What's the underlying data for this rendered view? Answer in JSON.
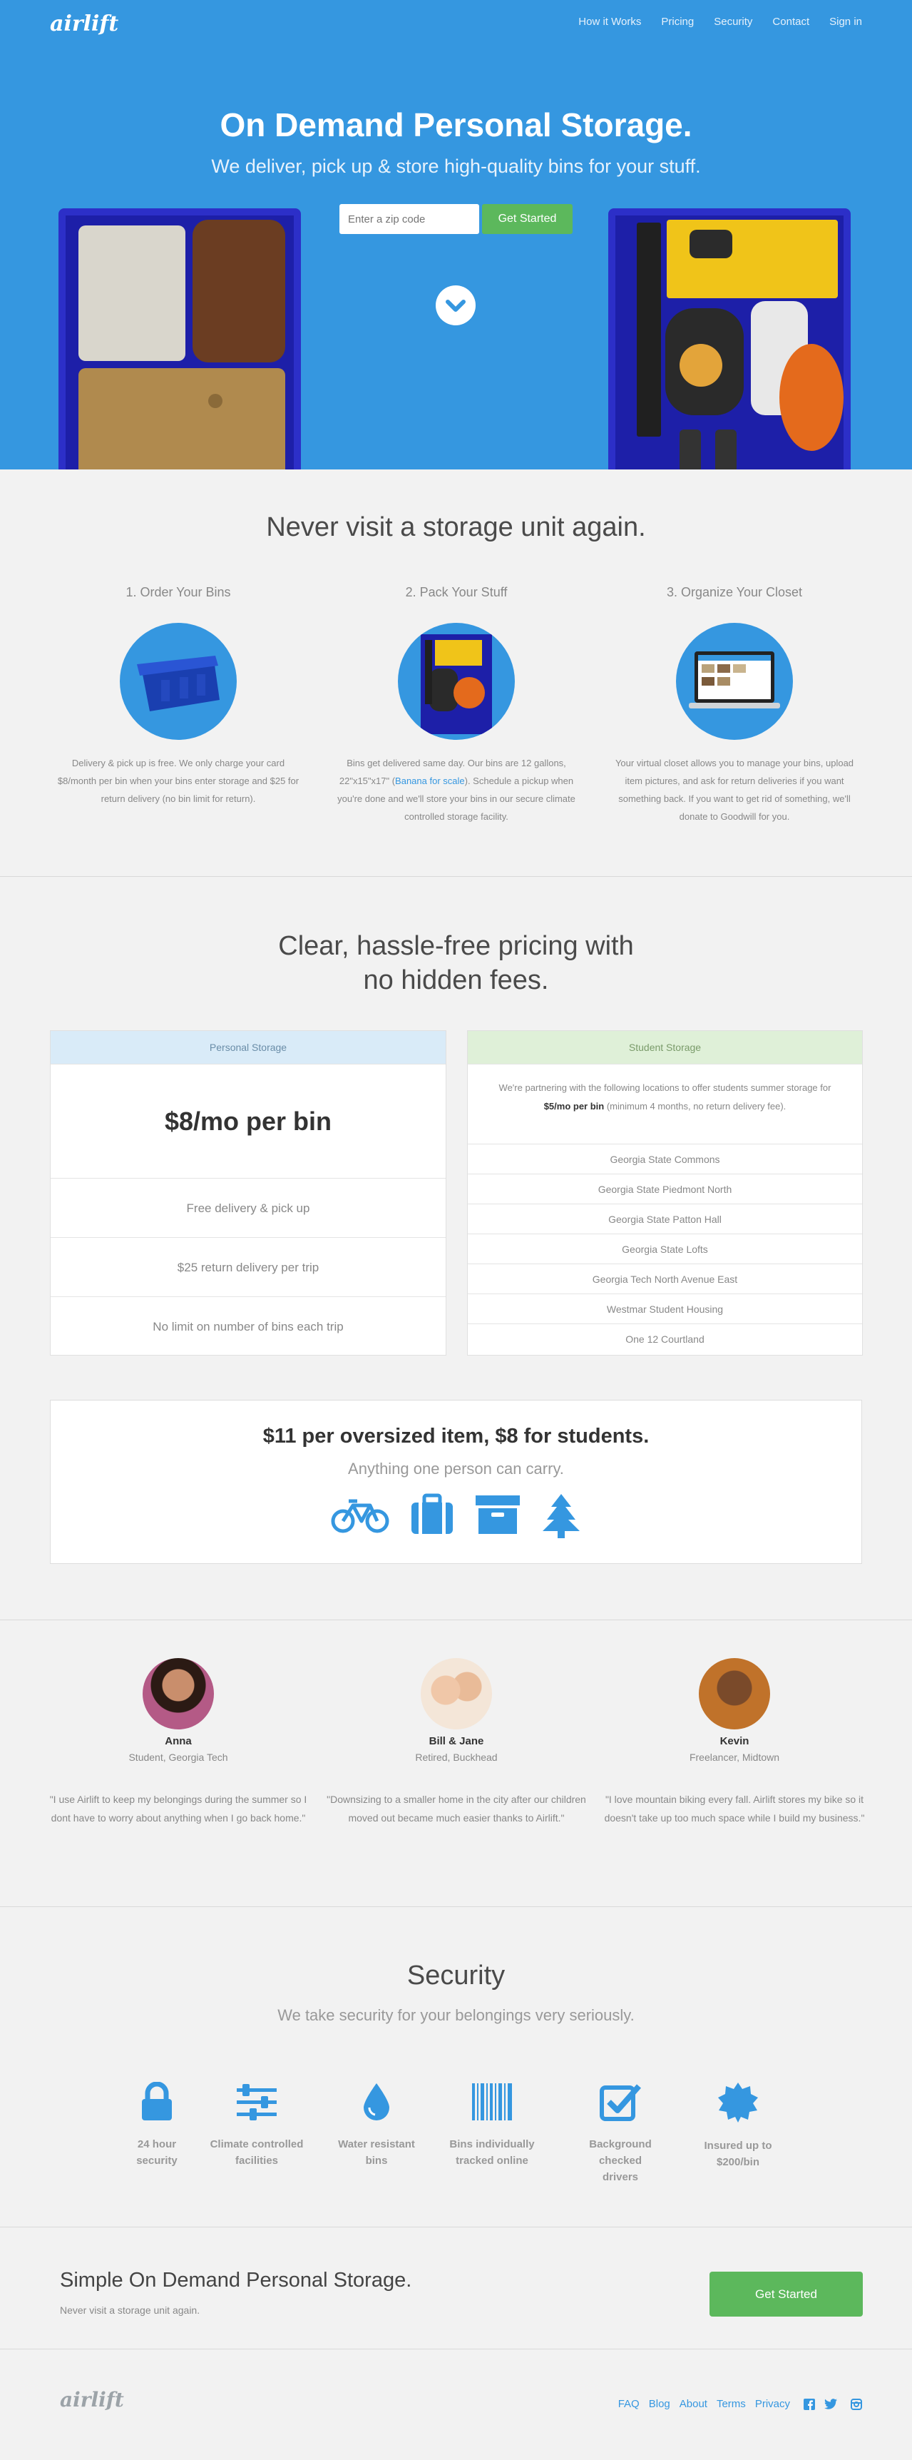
{
  "header": {
    "logo": "airlift",
    "nav": [
      "How it Works",
      "Pricing",
      "Security",
      "Contact",
      "Sign in"
    ]
  },
  "hero": {
    "title": "On Demand Personal Storage.",
    "subtitle": "We deliver, pick up & store high-quality bins for your stuff.",
    "zip_placeholder": "Enter a zip code",
    "cta": "Get Started"
  },
  "how": {
    "title": "Never visit a storage unit again.",
    "steps": [
      {
        "title": "1. Order Your Bins",
        "text": "Delivery & pick up is free. We only charge your card $8/month per bin when your bins enter storage and $25 for return delivery (no bin limit for return)."
      },
      {
        "title": "2. Pack Your Stuff",
        "text_a": "Bins get delivered same day. Our bins are 12 gallons, 22\"x15\"x17\" (",
        "link": "Banana for scale",
        "text_b": "). Schedule a pickup when you're done and we'll store your bins in our secure climate controlled storage facility."
      },
      {
        "title": "3. Organize Your Closet",
        "text": "Your virtual closet allows you to manage your bins, upload item pictures, and ask for return deliveries if you want something back. If you want to get rid of something, we'll donate to Goodwill for you."
      }
    ]
  },
  "pricing": {
    "title_line1": "Clear, hassle-free pricing with",
    "title_line2": "no hidden fees.",
    "personal": {
      "header": "Personal Storage",
      "price": "$8/mo per bin",
      "rows": [
        "Free delivery & pick up",
        "$25 return delivery per trip",
        "No limit on number of bins each trip"
      ]
    },
    "student": {
      "header": "Student Storage",
      "intro_a": "We're partnering with the following locations to offer students summer storage for ",
      "intro_bold": "$5/mo per bin",
      "intro_b": " (minimum 4 months, no return delivery fee).",
      "locations": [
        "Georgia State Commons",
        "Georgia State Piedmont North",
        "Georgia State Patton Hall",
        "Georgia State Lofts",
        "Georgia Tech North Avenue East",
        "Westmar Student Housing",
        "One 12 Courtland"
      ]
    },
    "oversize": {
      "title": "$11 per oversized item, $8 for students.",
      "subtitle": "Anything one person can carry.",
      "icons": [
        "bicycle-icon",
        "suitcase-icon",
        "box-icon",
        "tree-icon"
      ]
    }
  },
  "testimonials": [
    {
      "name": "Anna",
      "role": "Student, Georgia Tech",
      "quote": "\"I use Airlift to keep my belongings during the summer so I dont have to worry about anything when I go back home.\""
    },
    {
      "name": "Bill & Jane",
      "role": "Retired, Buckhead",
      "quote": "\"Downsizing to a smaller home in the city after our children moved out became much easier thanks to Airlift.\""
    },
    {
      "name": "Kevin",
      "role": "Freelancer, Midtown",
      "quote": "\"I love mountain biking every fall. Airlift stores my bike so it doesn't take up too much space while I build my business.\""
    }
  ],
  "security": {
    "title": "Security",
    "subtitle": "We take security for your belongings very seriously.",
    "features": [
      {
        "line1": "24 hour",
        "line2": "security",
        "icon": "lock-icon"
      },
      {
        "line1": "Climate controlled",
        "line2": "facilities",
        "icon": "sliders-icon"
      },
      {
        "line1": "Water resistant",
        "line2": "bins",
        "icon": "drop-icon"
      },
      {
        "line1": "Bins individually",
        "line2": "tracked online",
        "icon": "barcode-icon"
      },
      {
        "line1": "Background checked",
        "line2": "drivers",
        "icon": "checkbox-icon"
      },
      {
        "line1": "Insured up to",
        "line2": "$200/bin",
        "icon": "badge-icon"
      }
    ]
  },
  "cta": {
    "title": "Simple On Demand Personal Storage.",
    "subtitle": "Never visit a storage unit again.",
    "button": "Get Started"
  },
  "footer": {
    "logo": "airlift",
    "links": [
      "FAQ",
      "Blog",
      "About",
      "Terms",
      "Privacy"
    ],
    "social": [
      "facebook-icon",
      "twitter-icon",
      "instagram-icon"
    ]
  },
  "colors": {
    "brand_blue": "#3597e0",
    "green": "#5cb85c",
    "personal_header_bg": "#d9ebf8",
    "student_header_bg": "#dff0d8"
  }
}
